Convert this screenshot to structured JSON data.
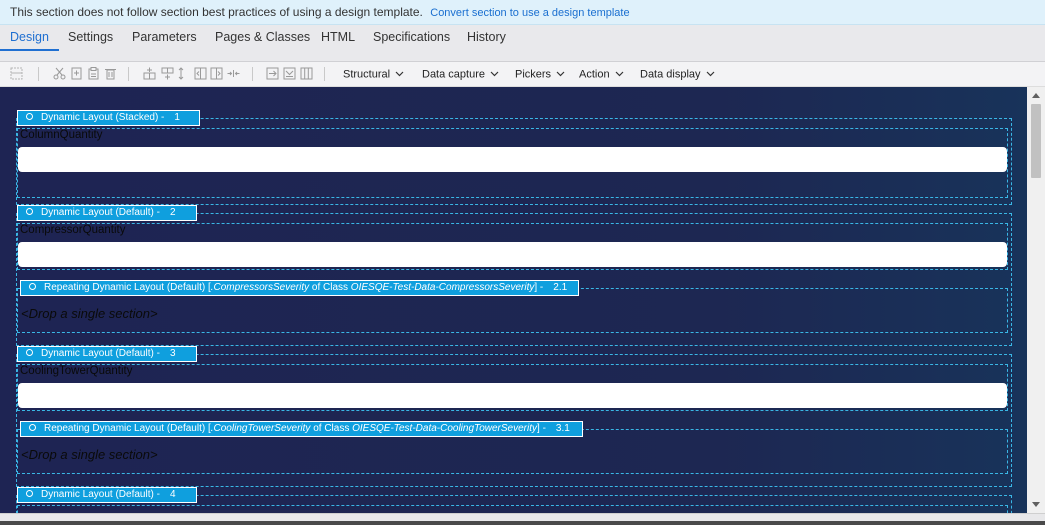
{
  "banner": {
    "message": "This section does not follow section best practices of using a design template.",
    "link": "Convert section to use a design template"
  },
  "tabs": [
    {
      "label": "Design",
      "active": true
    },
    {
      "label": "Settings"
    },
    {
      "label": "Parameters"
    },
    {
      "label": "Pages & Classes"
    },
    {
      "label": "HTML"
    },
    {
      "label": "Specifications"
    },
    {
      "label": "History"
    }
  ],
  "toolbar": {
    "icons": [
      "layout-icon",
      "cut-icon",
      "copy-icon",
      "paste-icon",
      "delete-icon",
      "insert-row-icon",
      "insert-column-icon",
      "move-icon",
      "move-left-icon",
      "move-right-icon",
      "split-icon",
      "wrap-icon",
      "unwrap-icon",
      "columns-icon"
    ],
    "menus": [
      "Structural",
      "Data capture",
      "Pickers",
      "Action",
      "Data display"
    ]
  },
  "layouts": [
    {
      "header": {
        "title": "Dynamic Layout (Stacked) -",
        "number": "1"
      },
      "field_label": "ColumnQuantity"
    },
    {
      "header": {
        "title": "Dynamic Layout (Default) -",
        "number": "2"
      },
      "field_label": "CompressorQuantity",
      "repeating": {
        "prefix": "Repeating Dynamic Layout (Default) [",
        "source": ".CompressorsSeverity",
        "of_class": " of Class ",
        "class_name": "OIESQE-Test-Data-CompressorsSeverity",
        "suffix": "] -",
        "number": "2.1",
        "drop_text": "<Drop a single section>"
      }
    },
    {
      "header": {
        "title": "Dynamic Layout (Default) -",
        "number": "3"
      },
      "field_label": "CoolingTowerQuantity",
      "repeating": {
        "prefix": "Repeating Dynamic Layout (Default) [",
        "source": ".CoolingTowerSeverity",
        "of_class": " of Class ",
        "class_name": "OIESQE-Test-Data-CoolingTowerSeverity",
        "suffix": "] -",
        "number": "3.1",
        "drop_text": "<Drop a single section>"
      }
    },
    {
      "header": {
        "title": "Dynamic Layout (Default) -",
        "number": "4"
      }
    }
  ],
  "colors": {
    "canvas": "#1e2453",
    "header_bg": "#0f9fde",
    "dashed_border": "#3ab7e6",
    "active_tab": "#1f6fd1"
  }
}
